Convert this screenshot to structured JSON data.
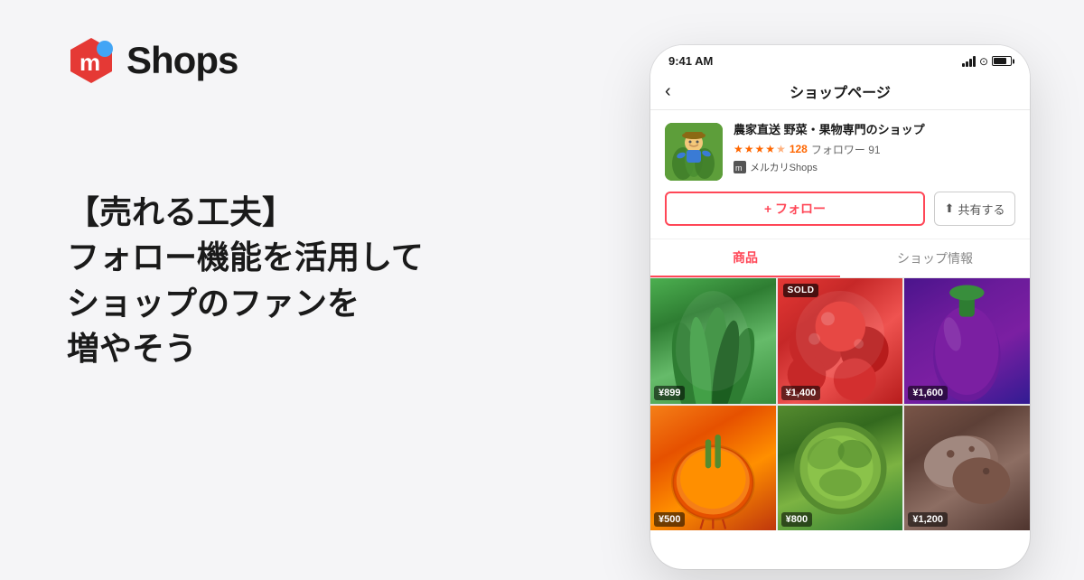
{
  "background": "#f5f5f7",
  "header": {
    "logo_text": "Shops"
  },
  "main_copy": {
    "line1": "【売れる工夫】",
    "line2": "フォロー機能を活用して",
    "line3": "ショップのファンを",
    "line4": "増やそう"
  },
  "phone": {
    "status_bar": {
      "time": "9:41 AM"
    },
    "nav": {
      "back_icon": "‹",
      "title": "ショップページ"
    },
    "shop": {
      "name": "農家直送 野菜・果物専門のショップ",
      "rating_count": "128",
      "followers": "フォロワー",
      "followers_count": "91",
      "badge": "メルカリShops",
      "follow_btn": "+ フォロー",
      "share_btn": "共有する"
    },
    "tabs": {
      "tab1": "商品",
      "tab2": "ショップ情報"
    },
    "products": [
      {
        "price": "¥899",
        "sold": false,
        "color": "veg-green"
      },
      {
        "price": "¥1,400",
        "sold": true,
        "color": "veg-red"
      },
      {
        "price": "¥1,600",
        "sold": false,
        "color": "veg-purple"
      },
      {
        "price": "¥500",
        "sold": false,
        "color": "veg-onion"
      },
      {
        "price": "¥800",
        "sold": false,
        "color": "veg-cabbage"
      },
      {
        "price": "¥1,200",
        "sold": false,
        "color": "veg-potato"
      }
    ]
  },
  "colors": {
    "accent": "#ff4757",
    "background": "#f5f5f7",
    "text_primary": "#1a1a1a",
    "star_color": "#ff6600"
  },
  "icons": {
    "back": "‹",
    "share": "⬆",
    "plus": "+",
    "star_full": "★",
    "star_half": "★"
  }
}
